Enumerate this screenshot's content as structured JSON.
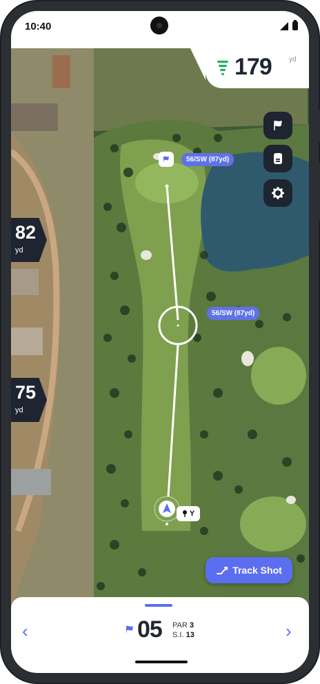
{
  "status": {
    "time": "10:40"
  },
  "distance": {
    "value": "179",
    "unit": "yd"
  },
  "side_markers": [
    {
      "value": "82",
      "unit": "yd"
    },
    {
      "value": "75",
      "unit": "yd"
    }
  ],
  "map_buttons": [
    "flag-icon",
    "scorecard-icon",
    "gear-icon"
  ],
  "shot_labels": {
    "to_green": "56/SW (87yd)",
    "to_target": "56/SW (87yd)"
  },
  "tee": {
    "label": "Y"
  },
  "track_shot": {
    "label": "Track Shot"
  },
  "hole": {
    "number": "05",
    "par_label": "PAR",
    "par": "3",
    "si_label": "S.I.",
    "si": "13"
  },
  "colors": {
    "accent": "#5b6ef0",
    "dark": "#1e2430",
    "distance_icon": "#19b55a"
  }
}
